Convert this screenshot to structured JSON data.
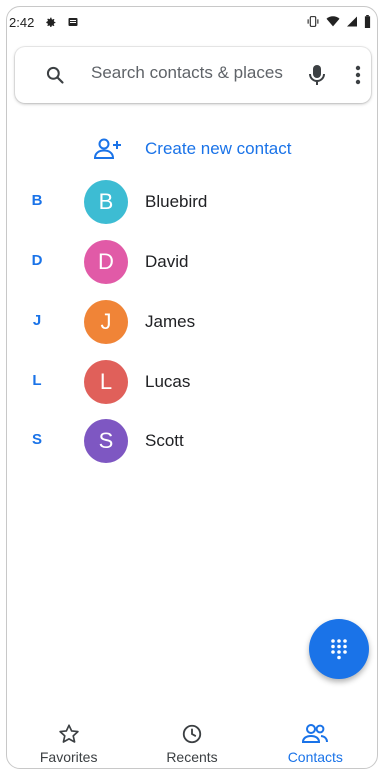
{
  "status_bar": {
    "time": "2:42"
  },
  "search": {
    "placeholder": "Search contacts & places"
  },
  "create_contact": {
    "label": "Create new contact"
  },
  "contacts": [
    {
      "index": "B",
      "initial": "B",
      "name": "Bluebird",
      "color": "#3dbcd3"
    },
    {
      "index": "D",
      "initial": "D",
      "name": "David",
      "color": "#e15aa7"
    },
    {
      "index": "J",
      "initial": "J",
      "name": "James",
      "color": "#f08437"
    },
    {
      "index": "L",
      "initial": "L",
      "name": "Lucas",
      "color": "#e0605a"
    },
    {
      "index": "S",
      "initial": "S",
      "name": "Scott",
      "color": "#7e57c2"
    }
  ],
  "bottom_nav": {
    "items": [
      {
        "label": "Favorites",
        "icon": "star-icon",
        "active": false
      },
      {
        "label": "Recents",
        "icon": "clock-icon",
        "active": false
      },
      {
        "label": "Contacts",
        "icon": "contacts-icon",
        "active": true
      }
    ]
  },
  "colors": {
    "accent": "#1a73e8"
  }
}
